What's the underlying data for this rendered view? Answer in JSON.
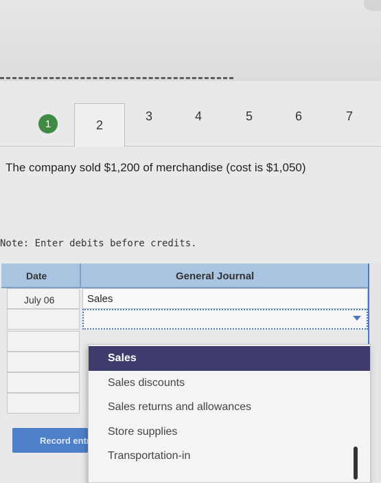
{
  "steps": {
    "completed": "1",
    "active": "2",
    "others": [
      "3",
      "4",
      "5",
      "6",
      "7"
    ]
  },
  "question": "The company sold $1,200 of merchandise (cost is $1,050)",
  "note": "Note: Enter debits before credits.",
  "journal": {
    "date_header": "Date",
    "journal_header": "General Journal",
    "rows": [
      {
        "date": "July 06",
        "account": "Sales"
      },
      {
        "date": "",
        "account": ""
      },
      {
        "date": "",
        "account": ""
      },
      {
        "date": "",
        "account": ""
      },
      {
        "date": "",
        "account": ""
      },
      {
        "date": "",
        "account": ""
      }
    ]
  },
  "dropdown": {
    "options": [
      "Sales",
      "Sales discounts",
      "Sales returns and allowances",
      "Store supplies",
      "Transportation-in"
    ],
    "selected": "Sales"
  },
  "record_button": "Record entry",
  "colors": {
    "completed_step": "#3f8b43",
    "header_bg": "#a8c4e0",
    "selected_option": "#3d3c6d",
    "button": "#4d80c9"
  }
}
